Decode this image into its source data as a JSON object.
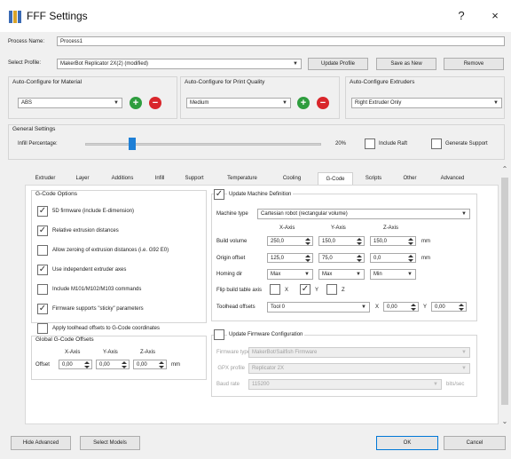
{
  "window": {
    "title": "FFF Settings",
    "help_label": "?",
    "close_label": "×"
  },
  "process": {
    "name_label": "Process Name:",
    "name_value": "Process1"
  },
  "profile": {
    "select_label": "Select Profile:",
    "select_value": "MakerBot Replicator 2X(2) (modified)",
    "update_label": "Update Profile",
    "save_as_new_label": "Save as New",
    "remove_label": "Remove"
  },
  "auto_config": {
    "material_title": "Auto-Configure for Material",
    "material_value": "ABS",
    "quality_title": "Auto-Configure for Print Quality",
    "quality_value": "Medium",
    "extruders_title": "Auto-Configure Extruders",
    "extruders_value": "Right Extruder Only"
  },
  "general": {
    "title": "General Settings",
    "infill_label": "Infill Percentage:",
    "infill_value": "20%",
    "infill_fraction": 0.2,
    "include_raft_label": "Include Raft",
    "include_raft_checked": false,
    "generate_support_label": "Generate Support",
    "generate_support_checked": false
  },
  "tabs": [
    {
      "label": "Extruder",
      "active": false
    },
    {
      "label": "Layer",
      "active": false
    },
    {
      "label": "Additions",
      "active": false
    },
    {
      "label": "Infill",
      "active": false
    },
    {
      "label": "Support",
      "active": false
    },
    {
      "label": "Temperature",
      "active": false
    },
    {
      "label": "Cooling",
      "active": false
    },
    {
      "label": "G-Code",
      "active": true
    },
    {
      "label": "Scripts",
      "active": false
    },
    {
      "label": "Other",
      "active": false
    },
    {
      "label": "Advanced",
      "active": false
    }
  ],
  "gcode_options": {
    "title": "G-Code Options",
    "items": [
      {
        "label": "5D firmware (include E-dimension)",
        "checked": true
      },
      {
        "label": "Relative extrusion distances",
        "checked": true
      },
      {
        "label": "Allow zeroing of extrusion distances (i.e. G92 E0)",
        "checked": false
      },
      {
        "label": "Use independent extruder axes",
        "checked": true
      },
      {
        "label": "Include M101/M102/M103 commands",
        "checked": false
      },
      {
        "label": "Firmware supports \"sticky\" parameters",
        "checked": true
      },
      {
        "label": "Apply toolhead offsets to G-Code coordinates",
        "checked": false
      }
    ]
  },
  "global_offsets": {
    "title": "Global G-Code Offsets",
    "x_axis": "X-Axis",
    "y_axis": "Y-Axis",
    "z_axis": "Z-Axis",
    "offset_label": "Offset",
    "x_value": "0,00",
    "y_value": "0,00",
    "z_value": "0,00",
    "unit": "mm"
  },
  "machine": {
    "update_label": "Update Machine Definition",
    "update_checked": true,
    "type_label": "Machine type",
    "type_value": "Cartesian robot (rectangular volume)",
    "x_axis": "X-Axis",
    "y_axis": "Y-Axis",
    "z_axis": "Z-Axis",
    "build_volume_label": "Build volume",
    "build_x": "250,0",
    "build_y": "150,0",
    "build_z": "150,0",
    "origin_label": "Origin offset",
    "origin_x": "125,0",
    "origin_y": "75,0",
    "origin_z": "0,0",
    "unit": "mm",
    "homing_label": "Homing dir",
    "homing_x": "Max",
    "homing_y": "Max",
    "homing_z": "Min",
    "flip_label": "Flip build table axis",
    "flip_x_label": "X",
    "flip_x_checked": false,
    "flip_y_label": "Y",
    "flip_y_checked": true,
    "flip_z_label": "Z",
    "flip_z_checked": false,
    "toolhead_label": "Toolhead offsets",
    "toolhead_value": "Tool 0",
    "toolhead_x_label": "X",
    "toolhead_x": "0,00",
    "toolhead_y_label": "Y",
    "toolhead_y": "0,00"
  },
  "firmware": {
    "update_label": "Update Firmware Configuration",
    "update_checked": false,
    "type_label": "Firmware type",
    "type_value": "MakerBot/Sailfish Firmware",
    "gpx_label": "GPX profile",
    "gpx_value": "Replicator 2X",
    "baud_label": "Baud rate",
    "baud_value": "115200",
    "baud_unit": "bits/sec"
  },
  "footer": {
    "hide_advanced_label": "Hide Advanced",
    "select_models_label": "Select Models",
    "ok_label": "OK",
    "cancel_label": "Cancel"
  }
}
